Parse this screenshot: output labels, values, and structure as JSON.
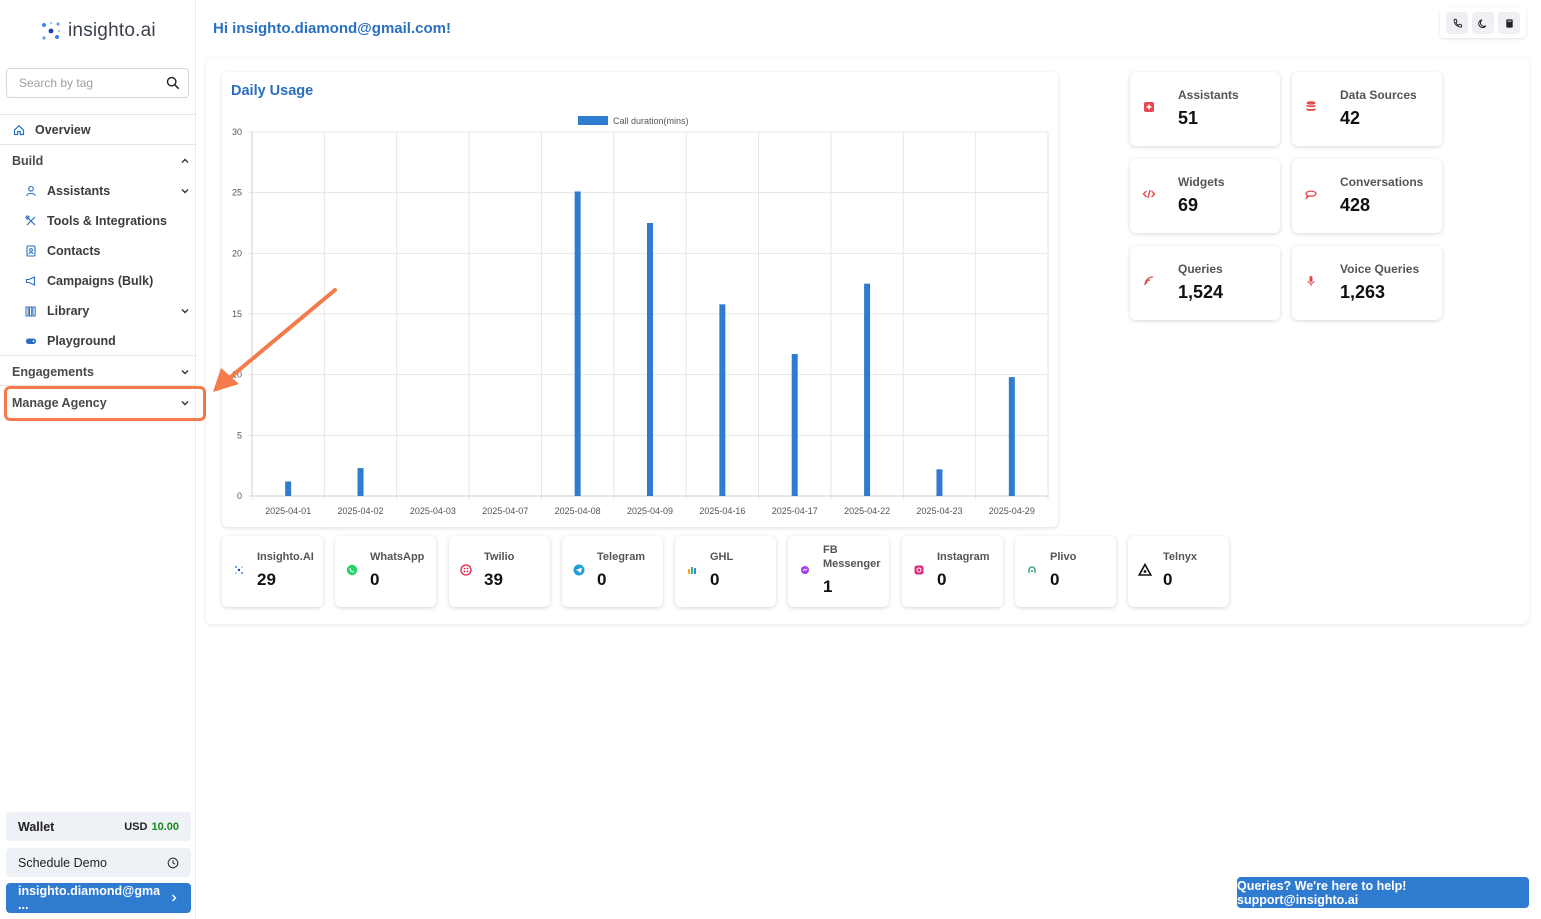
{
  "app": {
    "logo_text": "insighto.ai"
  },
  "search": {
    "placeholder": "Search by tag"
  },
  "nav": {
    "overview": "Overview",
    "build": "Build",
    "assistants": "Assistants",
    "tools": "Tools & Integrations",
    "contacts": "Contacts",
    "campaigns": "Campaigns (Bulk)",
    "library": "Library",
    "playground": "Playground",
    "engagements": "Engagements",
    "manage_agency": "Manage Agency"
  },
  "wallet": {
    "label": "Wallet",
    "currency": "USD",
    "amount": "10.00"
  },
  "schedule_demo": "Schedule Demo",
  "user_button": "insighto.diamond@gma ...",
  "greeting": "Hi insighto.diamond@gmail.com!",
  "chart_title": "Daily Usage",
  "chart_data": {
    "type": "bar",
    "categories": [
      "2025-04-01",
      "2025-04-02",
      "2025-04-03",
      "2025-04-07",
      "2025-04-08",
      "2025-04-09",
      "2025-04-16",
      "2025-04-17",
      "2025-04-22",
      "2025-04-23",
      "2025-04-29"
    ],
    "series": [
      {
        "name": "Call duration(mins)",
        "values": [
          1.2,
          2.3,
          0,
          0,
          25.1,
          22.5,
          15.8,
          11.7,
          17.5,
          2.2,
          9.8
        ],
        "color": "#2f7bd0"
      }
    ],
    "yticks": [
      0,
      5,
      10,
      15,
      20,
      25,
      30
    ],
    "ylim": [
      0,
      30
    ],
    "grid": true,
    "legend": "top"
  },
  "stats": [
    {
      "label": "Assistants",
      "value": "51",
      "icon": "assistant-icon"
    },
    {
      "label": "Data Sources",
      "value": "42",
      "icon": "database-icon"
    },
    {
      "label": "Widgets",
      "value": "69",
      "icon": "code-icon"
    },
    {
      "label": "Conversations",
      "value": "428",
      "icon": "chat-bubble-icon"
    },
    {
      "label": "Queries",
      "value": "1,524",
      "icon": "queries-icon"
    },
    {
      "label": "Voice Queries",
      "value": "1,263",
      "icon": "microphone-icon"
    }
  ],
  "channels": [
    {
      "label": "Insighto.AI",
      "value": "29"
    },
    {
      "label": "WhatsApp",
      "value": "0"
    },
    {
      "label": "Twilio",
      "value": "39"
    },
    {
      "label": "Telegram",
      "value": "0"
    },
    {
      "label": "GHL",
      "value": "0"
    },
    {
      "label": "FB Messenger",
      "value": "1"
    },
    {
      "label": "Instagram",
      "value": "0"
    },
    {
      "label": "Plivo",
      "value": "0"
    },
    {
      "label": "Telnyx",
      "value": "0"
    }
  ],
  "help_button": "Queries? We're here to help! support@insighto.ai",
  "colors": {
    "accent": "#2f7bd0",
    "annotation": "#f47b4c",
    "stat_icon": "#e5484d"
  }
}
